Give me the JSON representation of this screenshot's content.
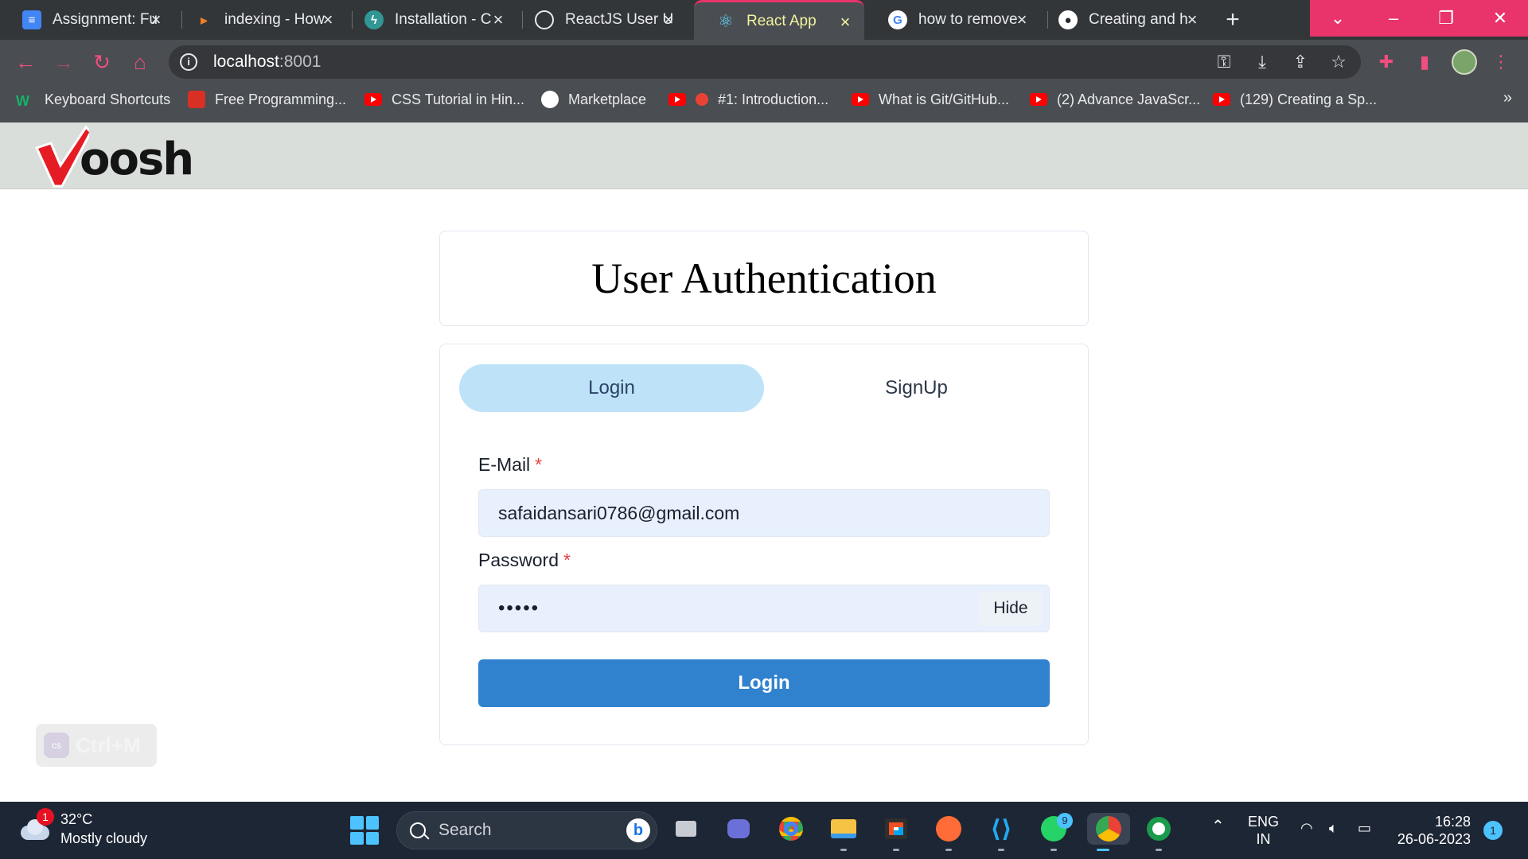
{
  "browser": {
    "tabs": [
      {
        "title": "Assignment: Fu",
        "icon": "docs-icon"
      },
      {
        "title": "indexing - How",
        "icon": "stackoverflow-icon"
      },
      {
        "title": "Installation - C",
        "icon": "chakra-icon"
      },
      {
        "title": "ReactJS User U",
        "icon": "chatgpt-icon"
      },
      {
        "title": "React App",
        "icon": "react-icon",
        "active": true
      },
      {
        "title": "how to remove",
        "icon": "google-icon"
      },
      {
        "title": "Creating and h",
        "icon": "github-icon"
      }
    ],
    "url_host": "localhost",
    "url_port": ":8001",
    "bookmarks": [
      {
        "label": "Keyboard Shortcuts",
        "icon": "wrike-icon"
      },
      {
        "label": "Free Programming...",
        "icon": "mycompiler-icon"
      },
      {
        "label": "CSS Tutorial in Hin...",
        "icon": "youtube-icon"
      },
      {
        "label": "Marketplace",
        "icon": "github-icon"
      },
      {
        "label": "#1: Introduction...",
        "icon": "youtube-icon"
      },
      {
        "label": "What is Git/GitHub...",
        "icon": "youtube-icon"
      },
      {
        "label": "(2) Advance JavaScr...",
        "icon": "youtube-icon"
      },
      {
        "label": "(129) Creating a Sp...",
        "icon": "youtube-icon"
      }
    ],
    "more_bookmarks": "»",
    "accent": "#e8336b"
  },
  "app": {
    "logo_text": "oosh",
    "title": "User Authentication",
    "tabs": {
      "login": "Login",
      "signup": "SignUp"
    },
    "email_label": "E-Mail",
    "email_value": "safaidansari0786@gmail.com",
    "password_label": "Password",
    "password_value": "•••••",
    "required_mark": "*",
    "hide_label": "Hide",
    "submit_label": "Login",
    "overlay_shortcut": "Ctrl+M",
    "overlay_badge": "cs",
    "colors": {
      "tab_selected": "#bee3f8",
      "button": "#3182ce",
      "input_bg": "#e8f0fe"
    }
  },
  "taskbar": {
    "weather_temp": "32°C",
    "weather_desc": "Mostly cloudy",
    "weather_badge": "1",
    "search_placeholder": "Search",
    "whatsapp_badge": "9",
    "lang_line1": "ENG",
    "lang_line2": "IN",
    "time": "16:28",
    "date": "26-06-2023",
    "notifications": "1"
  }
}
